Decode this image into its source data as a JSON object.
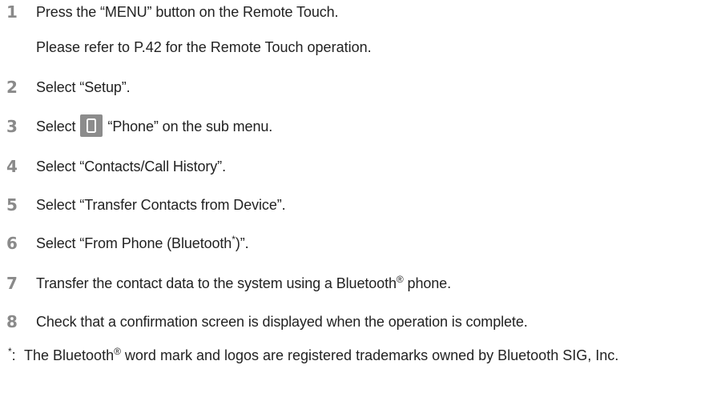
{
  "steps": [
    {
      "num": "1",
      "text": "Press the “MENU” button on the Remote Touch."
    },
    {
      "num": "2",
      "text": "Select “Setup”."
    },
    {
      "num": "3",
      "text_before": "Select",
      "text_after": "“Phone” on the sub menu."
    },
    {
      "num": "4",
      "text": "Select “Contacts/Call History”."
    },
    {
      "num": "5",
      "text": "Select “Transfer Contacts from Device”."
    },
    {
      "num": "6",
      "text_before": "Select “From Phone (Bluetooth",
      "sup": "*",
      "text_after": ")”."
    },
    {
      "num": "7",
      "text_before": "Transfer the contact data to the system using a Bluetooth",
      "sup": "®",
      "text_after": " phone."
    },
    {
      "num": "8",
      "text": "Check that a confirmation screen is displayed when the operation is complete."
    }
  ],
  "step1_note": "Please refer to P.42 for the Remote Touch operation.",
  "footnote": {
    "mark": "*",
    "colon": ":",
    "text_before": "The Bluetooth",
    "sup": "®",
    "text_after": " word mark and logos are registered trademarks owned by Bluetooth SIG, Inc."
  },
  "icons": {
    "step3_icon": "phone-icon",
    "icon_bg_color": "#8c8c8c"
  },
  "colors": {
    "step_number": "#8a8a8a",
    "text": "#222222"
  }
}
